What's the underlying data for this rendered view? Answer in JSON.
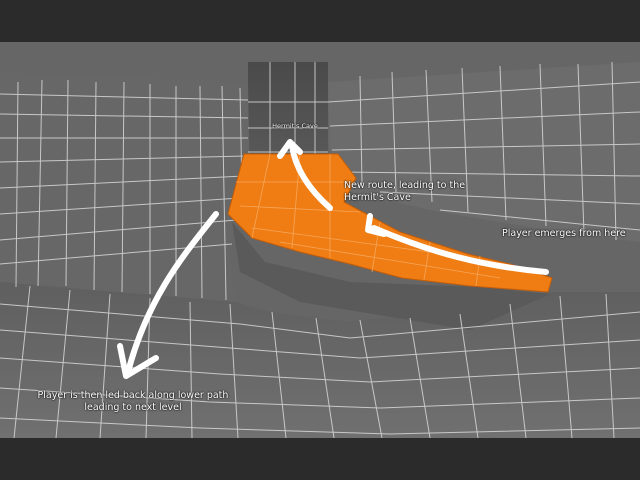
{
  "annotations": {
    "hermits_cave": "Hermit's Cave",
    "new_route": "New route, leading to the Hermit's Cave",
    "player_emerges": "Player emerges from here",
    "lower_path": "Player is then led back along lower path leading to next level"
  },
  "colors": {
    "letterbox": "#2b2b2b",
    "wall": "#6b6b6b",
    "grid": "#d8d8d8",
    "route_highlight": "#f07d14",
    "arrow": "#ffffff"
  },
  "arrows": [
    {
      "name": "arrow-to-hermits-cave",
      "direction": "toward-cave"
    },
    {
      "name": "arrow-new-route",
      "direction": "up-left"
    },
    {
      "name": "arrow-lower-path",
      "direction": "down-left"
    }
  ]
}
